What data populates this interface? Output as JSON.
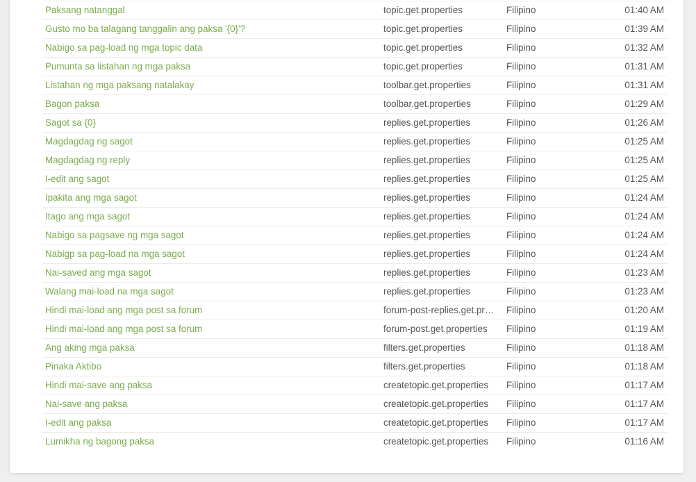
{
  "rows": [
    {
      "text": "Paksang natanggal",
      "key": "topic.get.properties",
      "lang": "Filipino",
      "time": "01:40 AM"
    },
    {
      "text": "Gusto mo ba talagang tanggalin ang paksa '{0}'?",
      "key": "topic.get.properties",
      "lang": "Filipino",
      "time": "01:39 AM"
    },
    {
      "text": "Nabigo sa pag-load ng mga topic data",
      "key": "topic.get.properties",
      "lang": "Filipino",
      "time": "01:32 AM"
    },
    {
      "text": "Pumunta sa listahan ng mga paksa",
      "key": "topic.get.properties",
      "lang": "Filipino",
      "time": "01:31 AM"
    },
    {
      "text": "Listahan ng mga paksang natalakay",
      "key": "toolbar.get.properties",
      "lang": "Filipino",
      "time": "01:31 AM"
    },
    {
      "text": "Bagon paksa",
      "key": "toolbar.get.properties",
      "lang": "Filipino",
      "time": "01:29 AM"
    },
    {
      "text": "Sagot sa {0}",
      "key": "replies.get.properties",
      "lang": "Filipino",
      "time": "01:26 AM"
    },
    {
      "text": "Magdagdag ng sagot",
      "key": "replies.get.properties",
      "lang": "Filipino",
      "time": "01:25 AM"
    },
    {
      "text": "Magdagdag ng reply",
      "key": "replies.get.properties",
      "lang": "Filipino",
      "time": "01:25 AM"
    },
    {
      "text": "I-edit ang sagot",
      "key": "replies.get.properties",
      "lang": "Filipino",
      "time": "01:25 AM"
    },
    {
      "text": "Ipakita ang mga sagot",
      "key": "replies.get.properties",
      "lang": "Filipino",
      "time": "01:24 AM"
    },
    {
      "text": "Itago ang mga sagot",
      "key": "replies.get.properties",
      "lang": "Filipino",
      "time": "01:24 AM"
    },
    {
      "text": "Nabigo sa pagsave ng mga sagot",
      "key": "replies.get.properties",
      "lang": "Filipino",
      "time": "01:24 AM"
    },
    {
      "text": "Nabigp sa pag-load na mga sagot",
      "key": "replies.get.properties",
      "lang": "Filipino",
      "time": "01:24 AM"
    },
    {
      "text": "Nai-saved ang mga sagot",
      "key": "replies.get.properties",
      "lang": "Filipino",
      "time": "01:23 AM"
    },
    {
      "text": "Walang mai-load na mga sagot",
      "key": "replies.get.properties",
      "lang": "Filipino",
      "time": "01:23 AM"
    },
    {
      "text": "Hindi mai-load ang mga post sa forum",
      "key": "forum-post-replies.get.properties",
      "lang": "Filipino",
      "time": "01:20 AM"
    },
    {
      "text": "Hindi mai-load ang mga post sa forum",
      "key": "forum-post.get.properties",
      "lang": "Filipino",
      "time": "01:19 AM"
    },
    {
      "text": "Ang aking mga paksa",
      "key": "filters.get.properties",
      "lang": "Filipino",
      "time": "01:18 AM"
    },
    {
      "text": "Pinaka Aktibo",
      "key": "filters.get.properties",
      "lang": "Filipino",
      "time": "01:18 AM"
    },
    {
      "text": "Hindi mai-save ang paksa",
      "key": "createtopic.get.properties",
      "lang": "Filipino",
      "time": "01:17 AM"
    },
    {
      "text": "Nai-save ang paksa",
      "key": "createtopic.get.properties",
      "lang": "Filipino",
      "time": "01:17 AM"
    },
    {
      "text": "I-edit ang paksa",
      "key": "createtopic.get.properties",
      "lang": "Filipino",
      "time": "01:17 AM"
    },
    {
      "text": "Lumikha ng bagong paksa",
      "key": "createtopic.get.properties",
      "lang": "Filipino",
      "time": "01:16 AM"
    }
  ],
  "colors": {
    "link": "#7aab4d",
    "text": "#555555",
    "divider": "#ececec"
  }
}
